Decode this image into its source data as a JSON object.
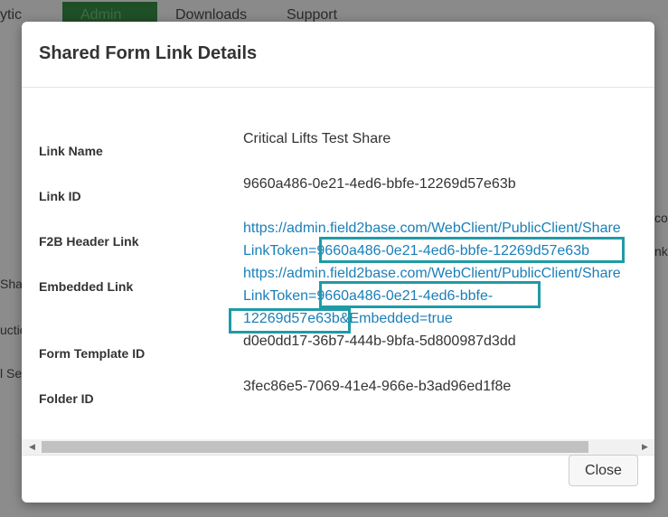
{
  "background": {
    "tabs": [
      "ytic",
      "Admin",
      "Downloads",
      "Support"
    ],
    "side_fragments": [
      "Sha",
      "uctio",
      "l Se"
    ],
    "right_fragments": [
      "co",
      "nk"
    ]
  },
  "modal": {
    "title": "Shared Form Link Details",
    "fields": [
      {
        "label": "Link Name",
        "value": "Critical Lifts Test Share"
      },
      {
        "label": "Link ID",
        "value": "9660a486-0e21-4ed6-bbfe-12269d57e63b"
      },
      {
        "label": "F2B Header Link",
        "lines": [
          "https://admin.field2base.com/WebClient/PublicClient/Share",
          "LinkToken=9660a486-0e21-4ed6-bbfe-12269d57e63b"
        ]
      },
      {
        "label": "Embedded Link",
        "lines": [
          "https://admin.field2base.com/WebClient/PublicClient/Share",
          "LinkToken=9660a486-0e21-4ed6-bbfe-",
          "12269d57e63b&Embedded=true"
        ]
      },
      {
        "label": "Form Template ID",
        "value": "d0e0dd17-36b7-444b-9bfa-5d800987d3dd"
      },
      {
        "label": "Folder ID",
        "value": "3fec86e5-7069-41e4-966e-b3ad96ed1f8e"
      }
    ],
    "close_label": "Close",
    "scroll_left": "◀",
    "scroll_right": "▶"
  }
}
